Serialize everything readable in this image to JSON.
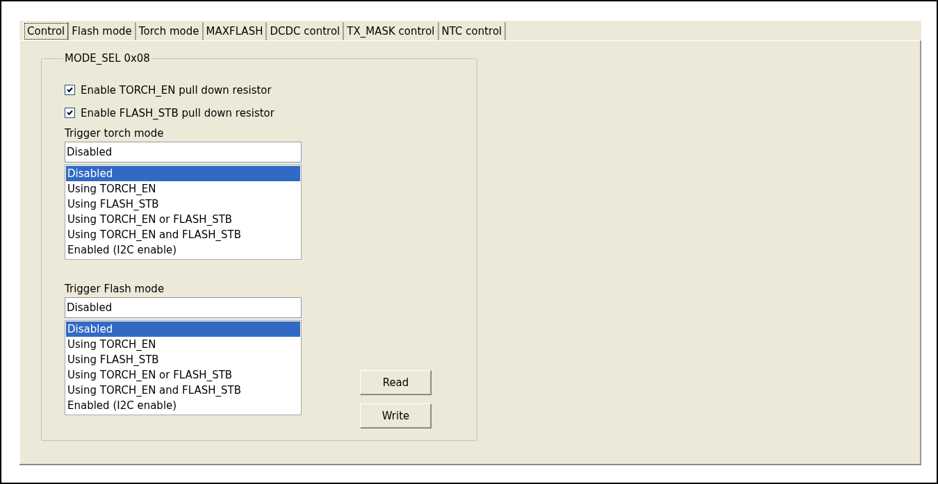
{
  "tabs": [
    {
      "label": "Control",
      "selected": true
    },
    {
      "label": "Flash mode",
      "selected": false
    },
    {
      "label": "Torch mode",
      "selected": false
    },
    {
      "label": "MAXFLASH",
      "selected": false
    },
    {
      "label": "DCDC control",
      "selected": false
    },
    {
      "label": "TX_MASK control",
      "selected": false
    },
    {
      "label": "NTC control",
      "selected": false
    }
  ],
  "group": {
    "title": "MODE_SEL 0x08",
    "checkboxes": [
      {
        "label": "Enable TORCH_EN pull down resistor",
        "checked": true
      },
      {
        "label": "Enable FLASH_STB pull down resistor",
        "checked": true
      }
    ],
    "triggers": [
      {
        "label": "Trigger torch mode",
        "value": "Disabled",
        "options": [
          {
            "label": "Disabled",
            "selected": true
          },
          {
            "label": "Using TORCH_EN",
            "selected": false
          },
          {
            "label": "Using FLASH_STB",
            "selected": false
          },
          {
            "label": "Using TORCH_EN or FLASH_STB",
            "selected": false
          },
          {
            "label": "Using TORCH_EN and FLASH_STB",
            "selected": false
          },
          {
            "label": "Enabled (I2C enable)",
            "selected": false
          }
        ]
      },
      {
        "label": "Trigger Flash mode",
        "value": "Disabled",
        "options": [
          {
            "label": "Disabled",
            "selected": true
          },
          {
            "label": "Using TORCH_EN",
            "selected": false
          },
          {
            "label": "Using FLASH_STB",
            "selected": false
          },
          {
            "label": "Using TORCH_EN or FLASH_STB",
            "selected": false
          },
          {
            "label": "Using TORCH_EN and FLASH_STB",
            "selected": false
          },
          {
            "label": "Enabled (I2C enable)",
            "selected": false
          }
        ]
      }
    ],
    "buttons": [
      "Read",
      "Write"
    ]
  }
}
